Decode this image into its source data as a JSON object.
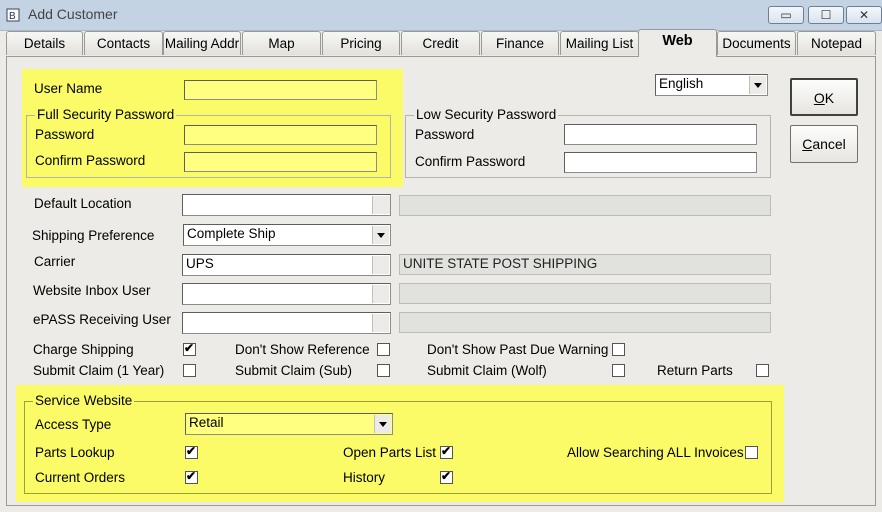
{
  "window": {
    "title": "Add Customer"
  },
  "tabs": [
    {
      "label": "Details"
    },
    {
      "label": "Contacts"
    },
    {
      "label": "Mailing Addr"
    },
    {
      "label": "Map"
    },
    {
      "label": "Pricing"
    },
    {
      "label": "Credit"
    },
    {
      "label": "Finance"
    },
    {
      "label": "Mailing List"
    },
    {
      "label": "Web"
    },
    {
      "label": "Documents"
    },
    {
      "label": "Notepad"
    }
  ],
  "active_tab": "Web",
  "form": {
    "user_name": {
      "label": "User Name",
      "value": ""
    },
    "full_security": {
      "title": "Full Security Password",
      "password_label": "Password",
      "confirm_label": "Confirm Password"
    },
    "low_security": {
      "title": "Low Security Password",
      "password_label": "Password",
      "confirm_label": "Confirm Password"
    },
    "language": {
      "value": "English"
    },
    "default_location": {
      "label": "Default Location",
      "value": "",
      "description": ""
    },
    "shipping_preference": {
      "label": "Shipping Preference",
      "value": "Complete Ship"
    },
    "carrier": {
      "label": "Carrier",
      "value": "UPS",
      "description": "UNITE STATE POST SHIPPING"
    },
    "website_inbox_user": {
      "label": "Website Inbox User",
      "value": ""
    },
    "epass_receiving_user": {
      "label": "ePASS Receiving User",
      "value": ""
    },
    "checkboxes": {
      "charge_shipping": {
        "label": "Charge Shipping",
        "checked": true
      },
      "dont_show_reference": {
        "label": "Don't Show Reference",
        "checked": false
      },
      "dont_show_past_due": {
        "label": "Don't Show Past Due Warning",
        "checked": false
      },
      "submit_claim_1yr": {
        "label": "Submit Claim (1 Year)",
        "checked": false
      },
      "submit_claim_sub": {
        "label": "Submit Claim (Sub)",
        "checked": false
      },
      "submit_claim_wolf": {
        "label": "Submit Claim (Wolf)",
        "checked": false
      },
      "return_parts": {
        "label": "Return Parts",
        "checked": false
      }
    },
    "service_website": {
      "title": "Service Website",
      "access_type": {
        "label": "Access Type",
        "value": "Retail"
      },
      "parts_lookup": {
        "label": "Parts Lookup",
        "checked": true
      },
      "open_parts_list": {
        "label": "Open Parts List",
        "checked": true
      },
      "allow_search_invoices": {
        "label": "Allow Searching ALL Invoices",
        "checked": false
      },
      "current_orders": {
        "label": "Current Orders",
        "checked": true
      },
      "history": {
        "label": "History",
        "checked": true
      }
    }
  },
  "buttons": {
    "ok_underline": "O",
    "ok_rest": "K",
    "cancel_underline": "C",
    "cancel_rest": "ancel"
  },
  "colors": {
    "highlight": "#fbfb67",
    "window_bg": "#ecebe7",
    "titlebar": "#c4d3e3"
  }
}
